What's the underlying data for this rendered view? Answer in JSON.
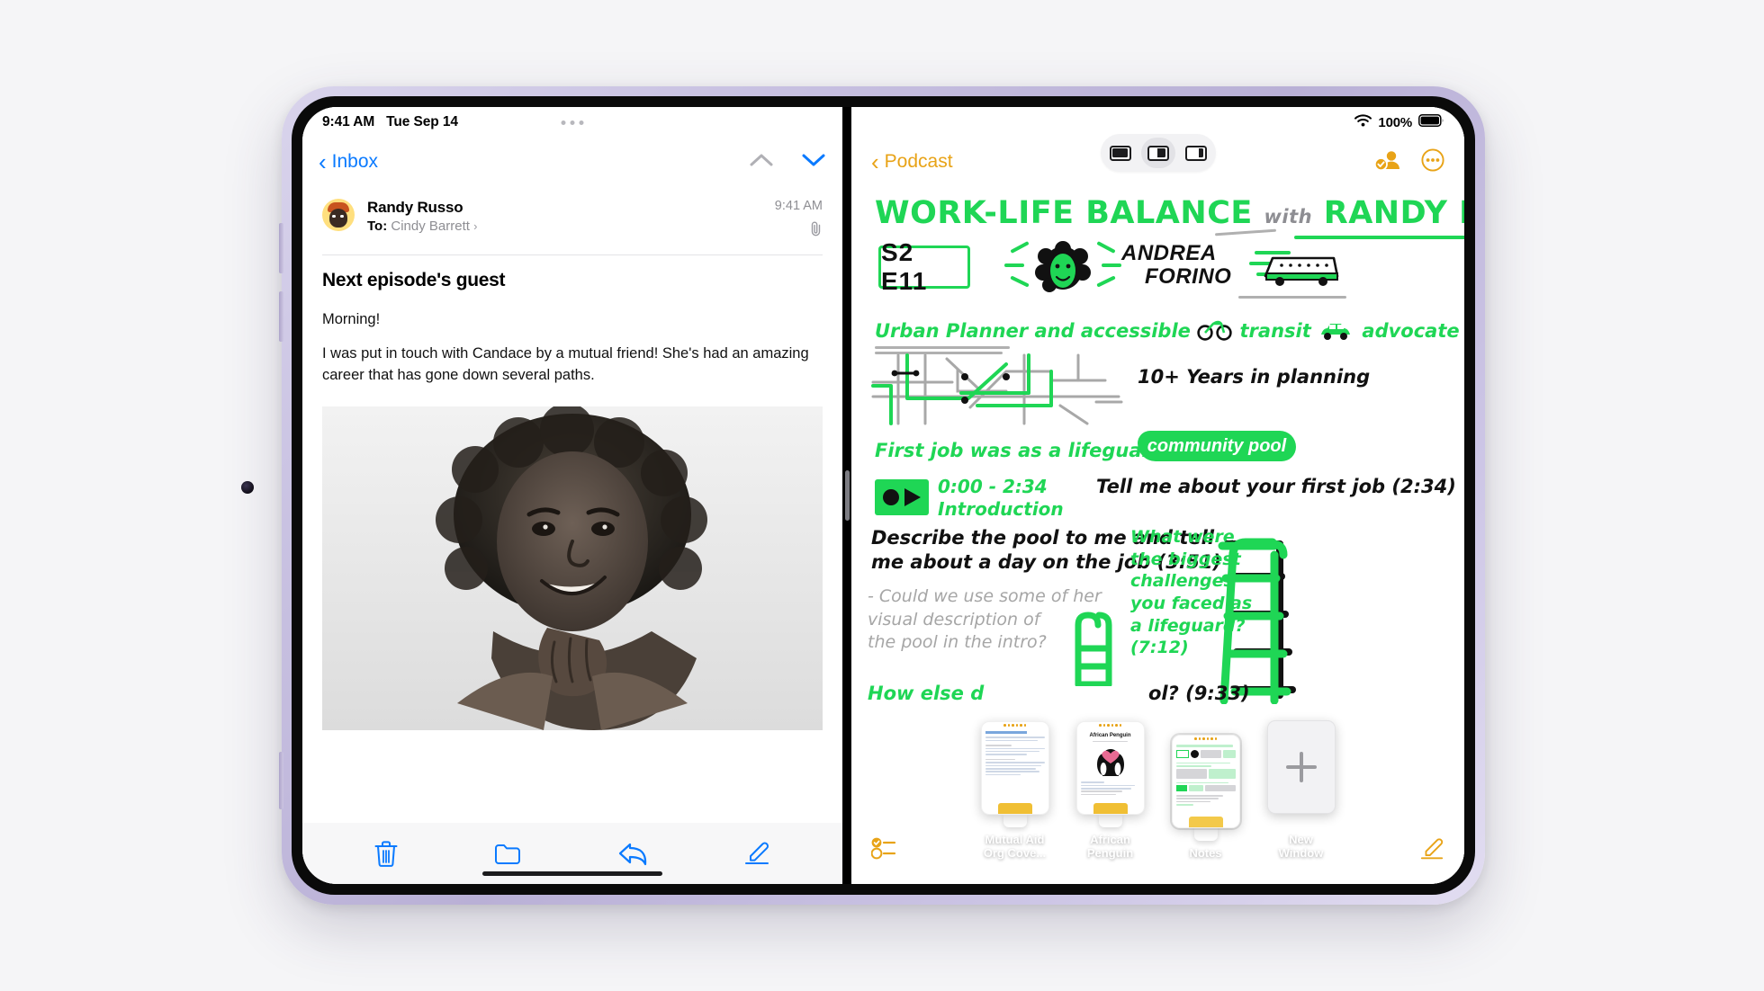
{
  "device": {
    "frame_color": "#b9b0d6"
  },
  "status_bar": {
    "time": "9:41 AM",
    "date": "Tue Sep 14",
    "wifi_icon": "wifi-icon",
    "battery_percent": "100%",
    "battery_icon": "battery-icon",
    "dots_icon": "multitask-dots-icon"
  },
  "mail": {
    "back_label": "Inbox",
    "back_icon": "chevron-left-icon",
    "nav_up_icon": "chevron-up-icon",
    "nav_down_icon": "chevron-down-icon",
    "accent": "#0a7aff",
    "message": {
      "sender": "Randy Russo",
      "to_label": "To:",
      "recipient": "Cindy Barrett",
      "recipient_arrow": "›",
      "timestamp": "9:41 AM",
      "attachment_icon": "paperclip-icon",
      "subject": "Next episode's guest",
      "body_line_1": "Morning!",
      "body_line_2": "I was put in touch with Candace by a mutual friend! She's had an amazing career that has gone down several paths.",
      "photo_alt": "black-and-white portrait of smiling woman"
    },
    "toolbar": {
      "delete_label": "trash-icon",
      "move_label": "folder-icon",
      "reply_label": "reply-icon",
      "compose_label": "compose-icon"
    }
  },
  "notes": {
    "back_label": "Podcast",
    "back_icon": "chevron-left-icon",
    "accent": "#e8a317",
    "share_icon": "add-person-icon",
    "more_icon": "more-ellipsis-icon",
    "checklist_icon": "checklist-icon",
    "compose_icon": "compose-icon",
    "multitask": {
      "fullscreen_label": "full-screen-icon",
      "split_label": "split-view-icon",
      "slideover_label": "slide-over-icon",
      "selected": "split-view-icon"
    },
    "note": {
      "title": "WORK-LIFE BALANCE",
      "title_with": "with",
      "title_host": "RANDY RUSSO",
      "episode_badge": "S2 E11",
      "guest_name_line1": "ANDREA",
      "guest_name_line2": "FORINO",
      "line_urban": "Urban Planner and accessible",
      "line_urban_2": "transit",
      "line_urban_3": "advocate",
      "years_label": "10+ Years in planning",
      "line_first_job": "First job was as a lifeguard at a",
      "highlight_pool": "community pool",
      "chapter_time": "0:00 - 2:34",
      "chapter_name": "Introduction",
      "question_1": "Tell me about your first job (2:34)",
      "question_2_line1": "Describe the pool to me and tell",
      "question_2_line2": "me about a day on the job (3:51)",
      "gray_note_line1": "- Could we use some of her",
      "gray_note_line2": "visual description of",
      "gray_note_line3": "the pool in the intro?",
      "question_3_line1": "What were",
      "question_3_line2": "the biggest",
      "question_3_line3": "challenges",
      "question_3_line4": "you faced as",
      "question_3_line5": "a lifeguard?",
      "question_3_line6": "(7:12)",
      "question_4_left": "How else d",
      "question_4_right": "ol? (9:33)"
    },
    "window_shelf": [
      {
        "label_line1": "Mutual Aid",
        "label_line2": "Org Cove...",
        "name": "mutual-aid-org-coverage"
      },
      {
        "label_line1": "African",
        "label_line2": "Penguin",
        "name": "african-penguin"
      },
      {
        "label_line1": "Notes",
        "label_line2": "",
        "name": "notes"
      },
      {
        "label_line1": "New",
        "label_line2": "Window",
        "name": "new-window"
      }
    ],
    "penguin_thumb_title": "African Penguin"
  }
}
